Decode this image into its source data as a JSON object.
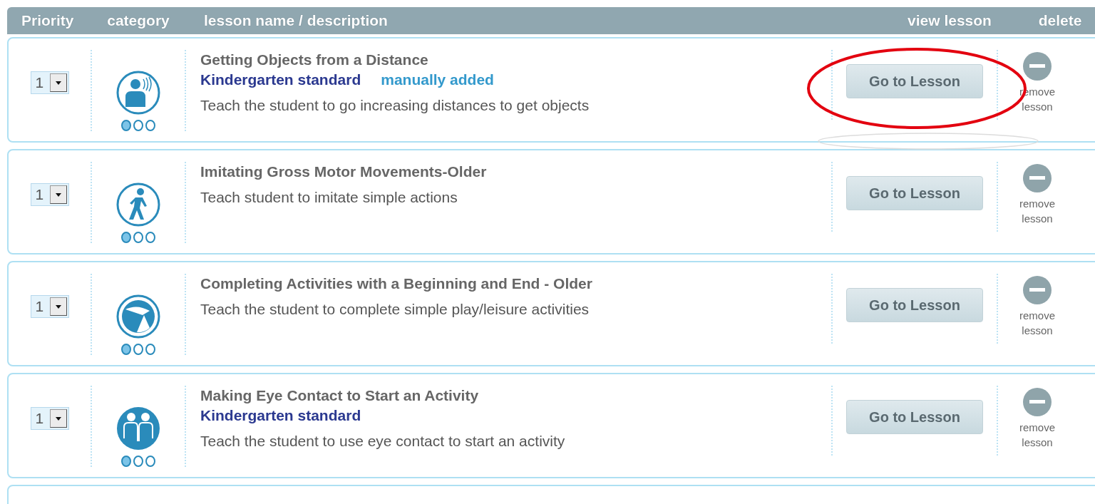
{
  "header": {
    "columns": [
      "Priority",
      "category",
      "lesson name / description",
      "view lesson",
      "delete"
    ]
  },
  "lessons": [
    {
      "priority": "1",
      "kind": "hearing",
      "stars": 1,
      "title": "Getting Objects from a Distance",
      "standard": "Kindergarten standard",
      "source": "manually added",
      "description": "Teach the student to go increasing distances to get objects",
      "button": "Go to Lesson",
      "remove": "remove lesson",
      "circled": true
    },
    {
      "priority": "1",
      "kind": "walking",
      "stars": 1,
      "title": "Imitating Gross Motor Movements-Older",
      "description": "Teach student to imitate simple actions",
      "button": "Go to Lesson",
      "remove": "remove lesson",
      "circled": false
    },
    {
      "priority": "1",
      "kind": "ball",
      "stars": 1,
      "title": "Completing Activities with a Beginning and End - Older",
      "description": "Teach the student to complete simple play/leisure activities",
      "button": "Go to Lesson",
      "remove": "remove lesson",
      "circled": false
    },
    {
      "priority": "1",
      "kind": "pair",
      "stars": 1,
      "title": "Making Eye Contact to Start an Activity",
      "standard": "Kindergarten standard",
      "description": "Teach the student to use eye contact to start an activity",
      "button": "Go to Lesson",
      "remove": "remove lesson",
      "circled": false
    }
  ]
}
